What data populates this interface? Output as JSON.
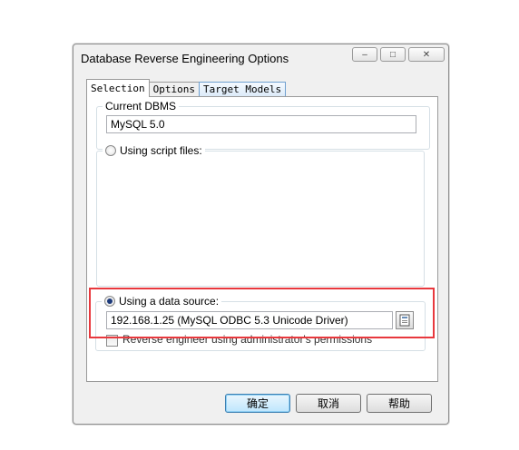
{
  "window": {
    "title": "Database Reverse Engineering Options",
    "controls": {
      "minimize": "–",
      "maximize": "□",
      "close": "✕"
    }
  },
  "tabs": [
    {
      "label": "Selection",
      "active": true
    },
    {
      "label": "Options",
      "active": false
    },
    {
      "label": "Target Models",
      "active": false
    }
  ],
  "current_dbms": {
    "label": "Current DBMS",
    "value": "MySQL 5.0"
  },
  "script_files": {
    "label": "Using script files:",
    "selected": false,
    "toolbar_icons": [
      "add-file-icon",
      "delete-icon",
      "move-up-icon",
      "move-down-icon",
      "edit-file-icon"
    ]
  },
  "data_source": {
    "label": "Using a data source:",
    "selected": true,
    "value": "192.168.1.25 (MySQL ODBC 5.3 Unicode Driver)"
  },
  "admin_permissions": {
    "label": "Reverse engineer using administrator's permissions",
    "checked": false
  },
  "buttons": {
    "ok": "确定",
    "cancel": "取消",
    "help": "帮助"
  },
  "colors": {
    "highlight": "#e8383d",
    "dialog_bg": "#f0f0f0"
  }
}
